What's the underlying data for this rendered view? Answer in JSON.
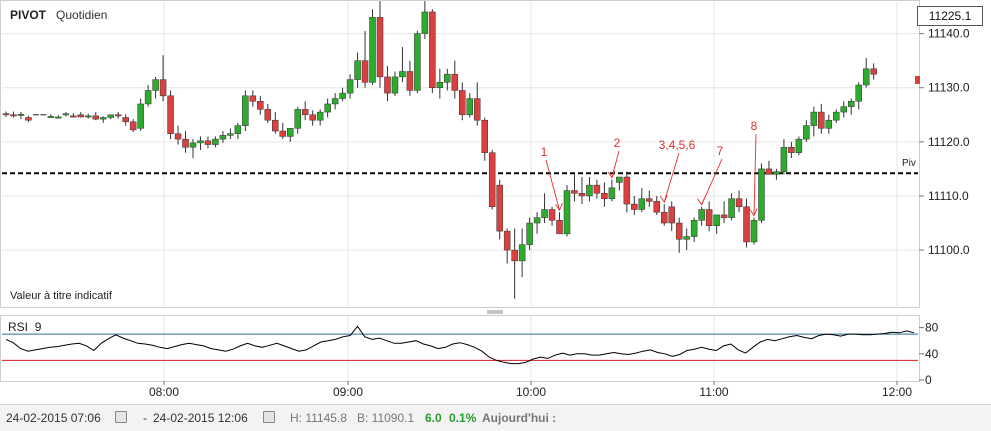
{
  "header": {
    "symbol": "PIVOT",
    "timeframe": "Quotidien",
    "last_price": "11225.1"
  },
  "note": "Valeur à titre indicatif",
  "pivot_label": "Piv",
  "rsi": {
    "label": "RSI",
    "period": "9"
  },
  "status": {
    "from": "24-02-2015 07:06",
    "to": "24-02-2015 12:06",
    "dash": "-",
    "high": "H: 11145.8",
    "low": "B: 11090.1",
    "change": "6.0",
    "change_pct": "0.1%",
    "today": "Aujourd'hui :"
  },
  "colors": {
    "up": "#2eaa2e",
    "down": "#d94040",
    "pivot": "#000000",
    "annotation": "#e03030",
    "rsi_line": "#000000",
    "rsi_upper": "#2a6f97",
    "rsi_lower": "#cc2020",
    "grid": "#e6e6e6"
  },
  "chart_data": [
    {
      "type": "candlestick",
      "x_time_labels": [
        "08:00",
        "09:00",
        "10:00",
        "11:00",
        "12:00"
      ],
      "y_ticks": [
        11100.0,
        11110.0,
        11120.0,
        11130.0,
        11140.0
      ],
      "ylim": [
        11089,
        11147
      ],
      "pivot_level": 11114.2,
      "ohlc": [
        [
          11125.2,
          11125.6,
          11124.6,
          11125.0
        ],
        [
          11125.0,
          11125.6,
          11124.5,
          11124.8
        ],
        [
          11124.9,
          11125.5,
          11124.2,
          11125.1
        ],
        [
          11124.5,
          11124.8,
          11123.6,
          11124.0
        ],
        [
          11125,
          11125,
          11125,
          11125
        ],
        [
          11125,
          11125,
          11125,
          11125
        ],
        [
          11124.7,
          11125.1,
          11124.4,
          11124.7
        ],
        [
          11124.5,
          11124.9,
          11124.3,
          11124.6
        ],
        [
          11125.0,
          11125.5,
          11124.7,
          11125.2
        ],
        [
          11124.8,
          11125.3,
          11124.5,
          11124.7
        ],
        [
          11125.0,
          11125.5,
          11124.5,
          11124.6
        ],
        [
          11124.6,
          11125.2,
          11124.3,
          11124.8
        ],
        [
          11124.8,
          11125.5,
          11124.0,
          11124.2
        ],
        [
          11124.2,
          11124.7,
          11123.5,
          11124.5
        ],
        [
          11124.5,
          11125.0,
          11124.2,
          11125.0
        ],
        [
          11125.0,
          11125.5,
          11124.3,
          11124.8
        ],
        [
          11124.5,
          11125.1,
          11123.0,
          11123.7
        ],
        [
          11123.7,
          11124.2,
          11121.8,
          11122.2
        ],
        [
          11122.5,
          11128.0,
          11122.0,
          11127.0
        ],
        [
          11127.0,
          11130.5,
          11126.5,
          11129.5
        ],
        [
          11129.5,
          11132.0,
          11128.0,
          11131.5
        ],
        [
          11131.5,
          11136.0,
          11127.5,
          11128.5
        ],
        [
          11128.5,
          11129.5,
          11120.5,
          11121.5
        ],
        [
          11121.5,
          11123.0,
          11119.5,
          11120.5
        ],
        [
          11120.5,
          11122.0,
          11118.0,
          11119.0
        ],
        [
          11119.0,
          11120.5,
          11117.0,
          11119.8
        ],
        [
          11119.8,
          11121.0,
          11118.5,
          11120.2
        ],
        [
          11120.2,
          11121.0,
          11118.8,
          11119.5
        ],
        [
          11119.5,
          11121.0,
          11119.0,
          11120.5
        ],
        [
          11120.5,
          11122.0,
          11119.8,
          11121.2
        ],
        [
          11121.2,
          11122.5,
          11120.5,
          11121.5
        ],
        [
          11121.5,
          11123.5,
          11120.5,
          11123.0
        ],
        [
          11123.0,
          11129.5,
          11122.0,
          11128.5
        ],
        [
          11128.5,
          11129.5,
          11126.5,
          11127.5
        ],
        [
          11127.5,
          11128.5,
          11125.0,
          11126.0
        ],
        [
          11126.0,
          11127.0,
          11123.5,
          11124.0
        ],
        [
          11124.0,
          11125.5,
          11121.5,
          11122.0
        ],
        [
          11122.0,
          11123.5,
          11120.5,
          11121.0
        ],
        [
          11121.0,
          11122.5,
          11120.0,
          11122.5
        ],
        [
          11122.5,
          11126.5,
          11121.5,
          11126.0
        ],
        [
          11126.0,
          11127.5,
          11124.0,
          11125.0
        ],
        [
          11125.0,
          11125.8,
          11123.0,
          11124.0
        ],
        [
          11124.0,
          11126.0,
          11123.0,
          11125.5
        ],
        [
          11125.5,
          11128.0,
          11124.5,
          11127.0
        ],
        [
          11127.0,
          11129.0,
          11126.0,
          11128.0
        ],
        [
          11128.0,
          11130.0,
          11127.5,
          11129.0
        ],
        [
          11129.0,
          11132.5,
          11128.0,
          11131.5
        ],
        [
          11131.5,
          11136.5,
          11130.0,
          11135.0
        ],
        [
          11135.0,
          11140.5,
          11130.0,
          11131.0
        ],
        [
          11131.0,
          11144.5,
          11130.5,
          11143.0
        ],
        [
          11143.0,
          11146.0,
          11130.0,
          11132.0
        ],
        [
          11132.0,
          11134.0,
          11127.5,
          11129.0
        ],
        [
          11129.0,
          11133.0,
          11128.5,
          11132.0
        ],
        [
          11132.0,
          11137.5,
          11131.0,
          11133.0
        ],
        [
          11133.0,
          11135.0,
          11128.5,
          11129.5
        ],
        [
          11129.5,
          11140.5,
          11129.0,
          11140.0
        ],
        [
          11140.0,
          11146.0,
          11139.0,
          11144.0
        ],
        [
          11144.0,
          11144.5,
          11129.0,
          11130.0
        ],
        [
          11130.0,
          11133.5,
          11128.0,
          11131.0
        ],
        [
          11131.0,
          11133.5,
          11129.5,
          11132.5
        ],
        [
          11132.5,
          11135.0,
          11128.0,
          11129.5
        ],
        [
          11129.5,
          11131.0,
          11124.0,
          11125.0
        ],
        [
          11125.0,
          11129.0,
          11124.5,
          11128.0
        ],
        [
          11128.0,
          11131.0,
          11123.0,
          11124.0
        ],
        [
          11124.0,
          11124.5,
          11116.5,
          11118.0
        ],
        [
          11118.0,
          11118.5,
          11107.5,
          11108.0
        ],
        [
          11112.0,
          11113.0,
          11102.0,
          11103.5
        ],
        [
          11103.5,
          11104.0,
          11097.5,
          11100.0
        ],
        [
          11100.0,
          11104.0,
          11091.0,
          11098.0
        ],
        [
          11098.0,
          11104.0,
          11095.0,
          11101.0
        ],
        [
          11101.0,
          11106.0,
          11100.0,
          11105.0
        ],
        [
          11105.0,
          11107.0,
          11103.0,
          11106.0
        ],
        [
          11106.0,
          11110.5,
          11105.0,
          11107.5
        ],
        [
          11107.5,
          11108.0,
          11104.5,
          11105.5
        ],
        [
          11105.5,
          11107.0,
          11103.0,
          11103.0
        ],
        [
          11103.0,
          11112.0,
          11102.5,
          11111.0
        ],
        [
          11111.0,
          11114.0,
          11109.0,
          11110.5
        ],
        [
          11110.5,
          11113.5,
          11108.5,
          11110.0
        ],
        [
          11110.0,
          11113.5,
          11109.0,
          11112.0
        ],
        [
          11112.0,
          11113.0,
          11109.5,
          11110.5
        ],
        [
          11110.5,
          11112.5,
          11108.0,
          11109.5
        ],
        [
          11109.5,
          11113.0,
          11109.0,
          11111.5
        ],
        [
          11112.5,
          11113.5,
          11111.0,
          11113.5
        ],
        [
          11113.5,
          11114.5,
          11107.0,
          11108.5
        ],
        [
          11108.5,
          11110.0,
          11106.5,
          11107.5
        ],
        [
          11107.5,
          11111.5,
          11107.0,
          11109.5
        ],
        [
          11109.5,
          11111.0,
          11108.0,
          11109.0
        ],
        [
          11109.0,
          11110.0,
          11106.5,
          11107.0
        ],
        [
          11107.0,
          11108.5,
          11104.5,
          11105.0
        ],
        [
          11108.0,
          11109.0,
          11103.5,
          11105.0
        ],
        [
          11105.0,
          11106.0,
          11099.5,
          11102.0
        ],
        [
          11102.0,
          11104.0,
          11100.0,
          11102.5
        ],
        [
          11102.5,
          11106.0,
          11101.5,
          11105.5
        ],
        [
          11105.5,
          11108.0,
          11104.5,
          11107.5
        ],
        [
          11107.5,
          11109.0,
          11103.5,
          11104.5
        ],
        [
          11104.5,
          11106.5,
          11103.0,
          11106.5
        ],
        [
          11106.5,
          11109.0,
          11105.0,
          11106.0
        ],
        [
          11106.0,
          11110.5,
          11105.5,
          11109.5
        ],
        [
          11109.5,
          11111.0,
          11107.0,
          11108.0
        ],
        [
          11108.0,
          11109.5,
          11100.5,
          11101.5
        ],
        [
          11101.5,
          11106.0,
          11101.0,
          11105.5
        ],
        [
          11105.5,
          11116.0,
          11105.0,
          11115.0
        ],
        [
          11115.0,
          11116.5,
          11114.0,
          11114.0
        ],
        [
          11114.0,
          11115.0,
          11113.0,
          11114.5
        ],
        [
          11114.5,
          11120.5,
          11114.0,
          11119.0
        ],
        [
          11119.0,
          11120.0,
          11117.0,
          11118.0
        ],
        [
          11118.0,
          11121.0,
          11117.5,
          11120.5
        ],
        [
          11120.5,
          11124.0,
          11120.0,
          11123.0
        ],
        [
          11123.0,
          11126.5,
          11121.0,
          11125.5
        ],
        [
          11125.5,
          11127.0,
          11121.5,
          11122.5
        ],
        [
          11122.5,
          11125.0,
          11121.5,
          11124.0
        ],
        [
          11124.0,
          11126.0,
          11123.5,
          11125.5
        ],
        [
          11125.5,
          11127.5,
          11124.5,
          11126.5
        ],
        [
          11126.5,
          11128.0,
          11125.0,
          11127.5
        ],
        [
          11127.5,
          11131.0,
          11126.0,
          11130.5
        ],
        [
          11130.5,
          11135.5,
          11130.0,
          11133.5
        ],
        [
          11133.5,
          11134.5,
          11131.5,
          11132.5
        ]
      ]
    },
    {
      "type": "line",
      "name": "RSI 9",
      "y_ticks": [
        0,
        40,
        80
      ],
      "ylim": [
        0,
        90
      ],
      "upper_band": 70,
      "lower_band": 30,
      "values": [
        62,
        57,
        48,
        44,
        46,
        48,
        50,
        51,
        53,
        55,
        56,
        52,
        45,
        56,
        63,
        69,
        64,
        60,
        56,
        55,
        53,
        50,
        48,
        51,
        54,
        56,
        54,
        52,
        48,
        46,
        44,
        47,
        52,
        56,
        52,
        50,
        53,
        56,
        52,
        48,
        44,
        46,
        52,
        58,
        60,
        62,
        66,
        68,
        82,
        66,
        62,
        64,
        60,
        56,
        56,
        58,
        60,
        55,
        52,
        48,
        50,
        55,
        57,
        54,
        50,
        44,
        35,
        30,
        27,
        25,
        25,
        27,
        32,
        35,
        33,
        38,
        41,
        38,
        40,
        40,
        38,
        38,
        40,
        42,
        40,
        39,
        41,
        44,
        46,
        42,
        40,
        36,
        39,
        45,
        47,
        50,
        47,
        45,
        52,
        55,
        46,
        41,
        50,
        58,
        62,
        60,
        63,
        66,
        68,
        65,
        63,
        68,
        70,
        69,
        67,
        70,
        70,
        69,
        69,
        70,
        71,
        73,
        72,
        75,
        72
      ]
    }
  ],
  "annotations": [
    {
      "label": "1",
      "target_candle": 74
    },
    {
      "label": "2",
      "target_candle": 81
    },
    {
      "label": "3,4,5,6",
      "target_candle": 88
    },
    {
      "label": "7",
      "target_candle": 93
    },
    {
      "label": "8",
      "target_candle": 100
    }
  ]
}
